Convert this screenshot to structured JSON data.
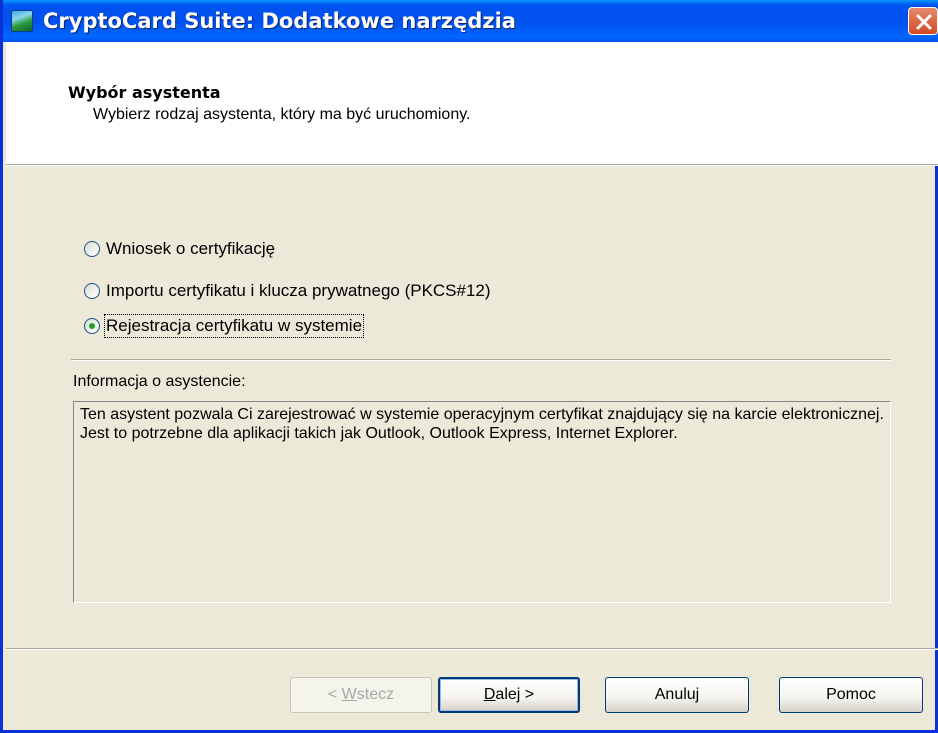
{
  "window": {
    "title": "CryptoCard Suite: Dodatkowe narzędzia",
    "icon": "cryptocard-app-icon",
    "close_icon": "close-icon"
  },
  "header": {
    "title": "Wybór asystenta",
    "subtitle": "Wybierz rodzaj asystenta, który ma być uruchomiony."
  },
  "options": [
    {
      "label": "Wniosek o certyfikację",
      "checked": false
    },
    {
      "label": "Importu certyfikatu i klucza prywatnego (PKCS#12)",
      "checked": false
    },
    {
      "label": "Rejestracja certyfikatu w systemie",
      "checked": true
    }
  ],
  "info": {
    "label": "Informacja o asystencie:",
    "text": "Ten asystent pozwala Ci zarejestrować w systemie operacyjnym certyfikat znajdujący się na karcie elektronicznej. Jest to potrzebne dla aplikacji takich jak Outlook, Outlook Express, Internet Explorer."
  },
  "buttons": {
    "back": {
      "prefix": "< ",
      "accel": "W",
      "rest": "stecz",
      "enabled": false
    },
    "next": {
      "accel": "D",
      "rest": "alej >",
      "enabled": true
    },
    "cancel": "Anuluj",
    "help": "Pomoc"
  },
  "colors": {
    "titlebar": "#0054e3",
    "dialog_bg": "#ece9d8",
    "header_bg": "#ffffff",
    "close_button": "#d8542a",
    "radio_dot": "#21a121"
  }
}
